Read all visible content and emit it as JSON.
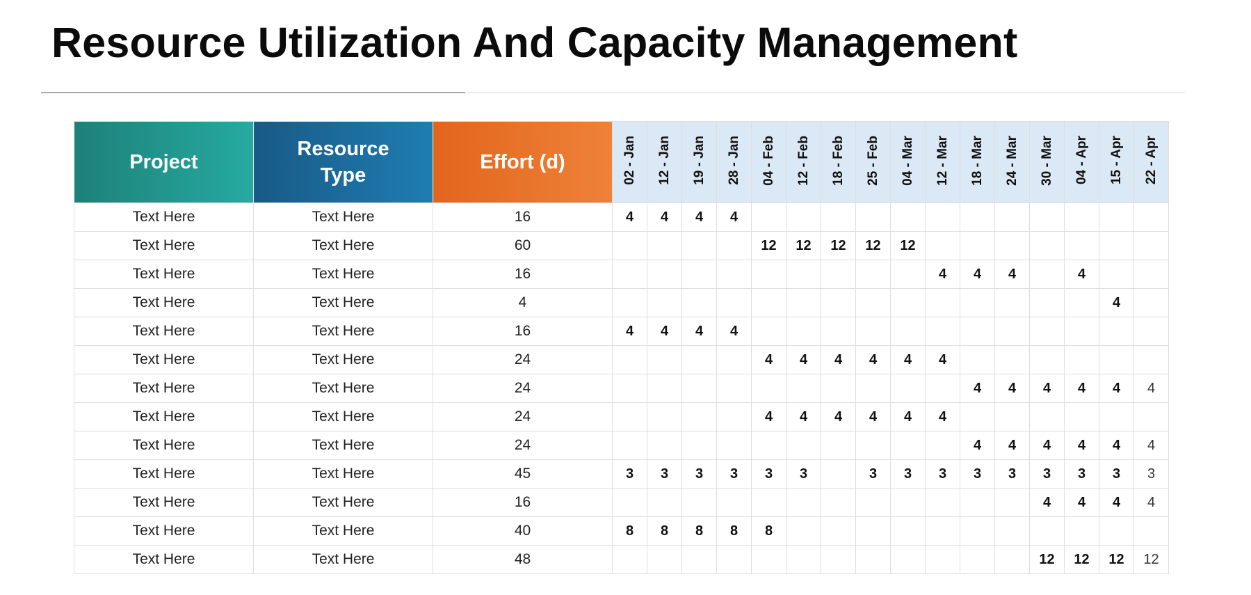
{
  "title": "Resource Utilization And Capacity Management",
  "table": {
    "headers": {
      "project": "Project",
      "resource_type_line1": "Resource",
      "resource_type_line2": "Type",
      "effort": "Effort (d)"
    },
    "dates": [
      "02 - Jan",
      "12 - Jan",
      "19 - Jan",
      "28 - Jan",
      "04 - Feb",
      "12 - Feb",
      "18 - Feb",
      "25 - Feb",
      "04 - Mar",
      "12 - Mar",
      "18 - Mar",
      "24 - Mar",
      "30 - Mar",
      "04 - Apr",
      "15 - Apr",
      "22 - Apr"
    ],
    "rows": [
      {
        "project": "Text Here",
        "resource_type": "Text Here",
        "effort": "16",
        "alloc": [
          "4",
          "4",
          "4",
          "4",
          "",
          "",
          "",
          "",
          "",
          "",
          "",
          "",
          "",
          "",
          "",
          ""
        ]
      },
      {
        "project": "Text Here",
        "resource_type": "Text Here",
        "effort": "60",
        "alloc": [
          "",
          "",
          "",
          "",
          "12",
          "12",
          "12",
          "12",
          "12",
          "",
          "",
          "",
          "",
          "",
          "",
          ""
        ]
      },
      {
        "project": "Text Here",
        "resource_type": "Text Here",
        "effort": "16",
        "alloc": [
          "",
          "",
          "",
          "",
          "",
          "",
          "",
          "",
          "",
          "4",
          "4",
          "4",
          "",
          "4",
          "",
          ""
        ]
      },
      {
        "project": "Text Here",
        "resource_type": "Text Here",
        "effort": "4",
        "alloc": [
          "",
          "",
          "",
          "",
          "",
          "",
          "",
          "",
          "",
          "",
          "",
          "",
          "",
          "",
          "4",
          ""
        ]
      },
      {
        "project": "Text Here",
        "resource_type": "Text Here",
        "effort": "16",
        "alloc": [
          "4",
          "4",
          "4",
          "4",
          "",
          "",
          "",
          "",
          "",
          "",
          "",
          "",
          "",
          "",
          "",
          ""
        ]
      },
      {
        "project": "Text Here",
        "resource_type": "Text Here",
        "effort": "24",
        "alloc": [
          "",
          "",
          "",
          "",
          "4",
          "4",
          "4",
          "4",
          "4",
          "4",
          "",
          "",
          "",
          "",
          "",
          ""
        ]
      },
      {
        "project": "Text Here",
        "resource_type": "Text Here",
        "effort": "24",
        "alloc": [
          "",
          "",
          "",
          "",
          "",
          "",
          "",
          "",
          "",
          "",
          "4",
          "4",
          "4",
          "4",
          "4",
          "4"
        ]
      },
      {
        "project": "Text Here",
        "resource_type": "Text Here",
        "effort": "24",
        "alloc": [
          "",
          "",
          "",
          "",
          "4",
          "4",
          "4",
          "4",
          "4",
          "4",
          "",
          "",
          "",
          "",
          "",
          ""
        ]
      },
      {
        "project": "Text Here",
        "resource_type": "Text Here",
        "effort": "24",
        "alloc": [
          "",
          "",
          "",
          "",
          "",
          "",
          "",
          "",
          "",
          "",
          "4",
          "4",
          "4",
          "4",
          "4",
          "4"
        ]
      },
      {
        "project": "Text Here",
        "resource_type": "Text Here",
        "effort": "45",
        "alloc": [
          "3",
          "3",
          "3",
          "3",
          "3",
          "3",
          "",
          "3",
          "3",
          "3",
          "3",
          "3",
          "3",
          "3",
          "3",
          "3"
        ]
      },
      {
        "project": "Text Here",
        "resource_type": "Text Here",
        "effort": "16",
        "alloc": [
          "",
          "",
          "",
          "",
          "",
          "",
          "",
          "",
          "",
          "",
          "",
          "",
          "4",
          "4",
          "4",
          "4"
        ]
      },
      {
        "project": "Text Here",
        "resource_type": "Text Here",
        "effort": "40",
        "alloc": [
          "8",
          "8",
          "8",
          "8",
          "8",
          "",
          "",
          "",
          "",
          "",
          "",
          "",
          "",
          "",
          "",
          ""
        ]
      },
      {
        "project": "Text Here",
        "resource_type": "Text Here",
        "effort": "48",
        "alloc": [
          "",
          "",
          "",
          "",
          "",
          "",
          "",
          "",
          "",
          "",
          "",
          "",
          "12",
          "12",
          "12",
          "12"
        ]
      }
    ]
  }
}
